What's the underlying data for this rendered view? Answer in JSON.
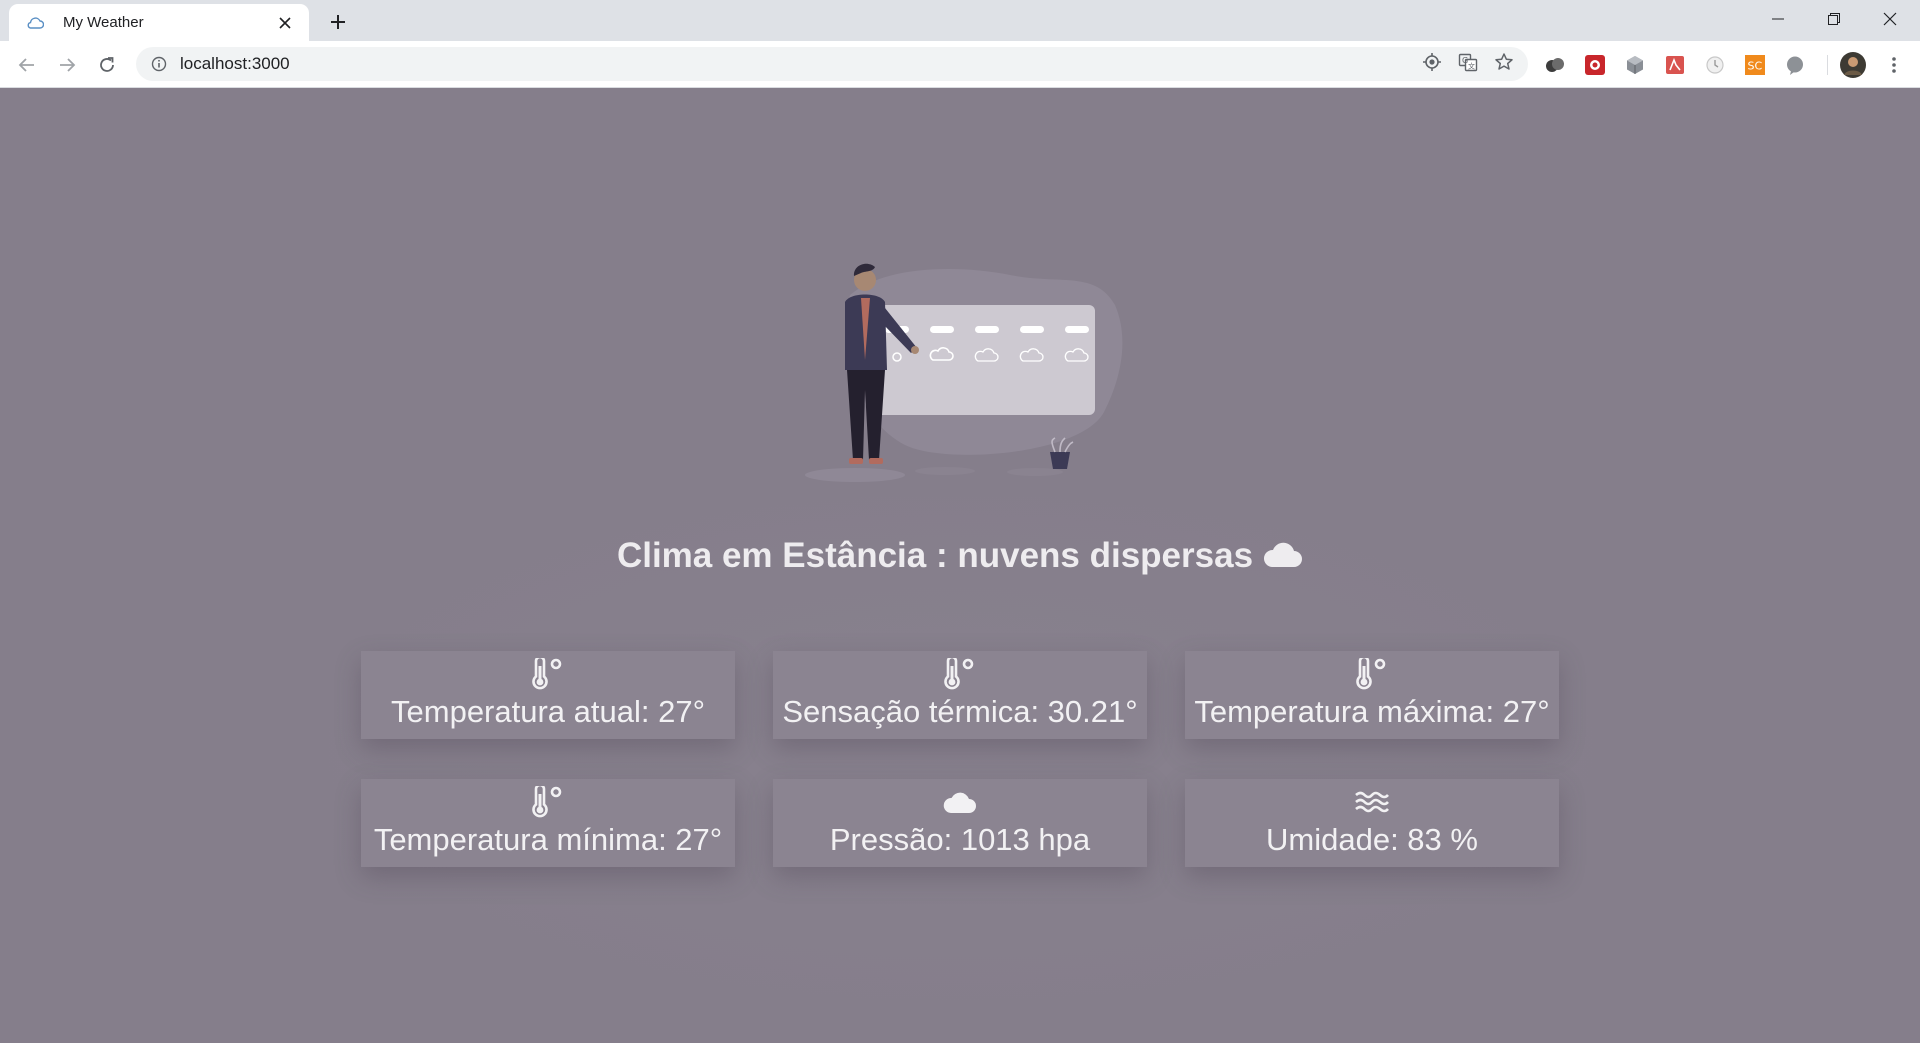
{
  "browser": {
    "tab_title": "My Weather",
    "url": "localhost:3000"
  },
  "page": {
    "headline": "Clima em Estância : nuvens dispersas",
    "headline_icon": "cloud-icon",
    "cards": [
      {
        "label": "Temperatura atual: 27°",
        "icon": "thermometer-icon"
      },
      {
        "label": "Sensação térmica: 30.21°",
        "icon": "thermometer-icon"
      },
      {
        "label": "Temperatura máxima: 27°",
        "icon": "thermometer-icon"
      },
      {
        "label": "Temperatura mínima: 27°",
        "icon": "thermometer-icon"
      },
      {
        "label": "Pressão: 1013 hpa",
        "icon": "cloud-icon"
      },
      {
        "label": "Umidade: 83 %",
        "icon": "water-waves-icon"
      }
    ]
  },
  "colors": {
    "background": "#857e8b",
    "card": "#8b8491",
    "text": "#f2f1f3"
  }
}
